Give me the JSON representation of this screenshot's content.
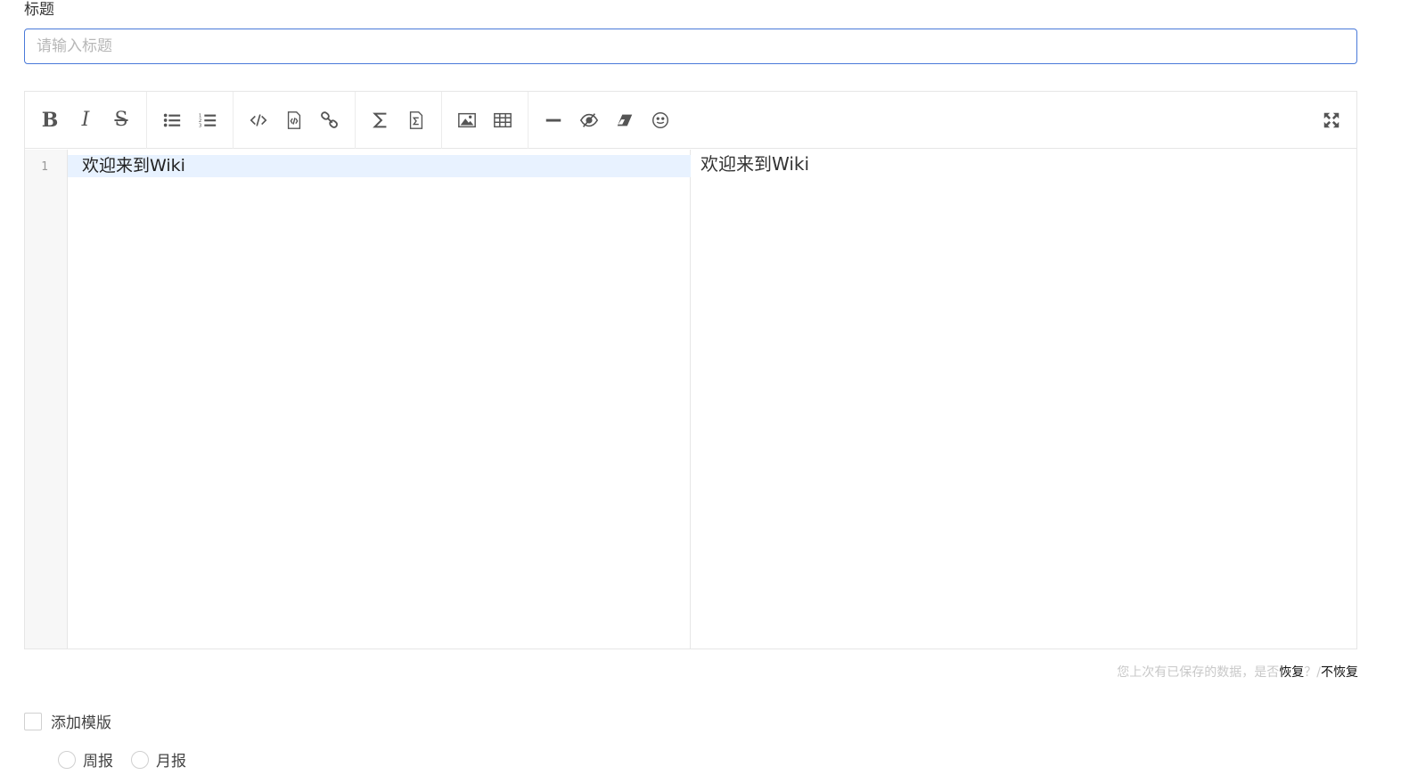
{
  "form": {
    "title_label": "标题",
    "title_placeholder": "请输入标题",
    "title_value": ""
  },
  "editor": {
    "toolbar": {
      "bold": "B",
      "italic": "I",
      "strike": "S",
      "icons": [
        "bold-icon",
        "italic-icon",
        "strikethrough-icon",
        "bullet-list-icon",
        "numbered-list-icon",
        "code-icon",
        "code-block-icon",
        "link-icon",
        "math-icon",
        "math-block-icon",
        "image-icon",
        "table-icon",
        "horizontal-rule-icon",
        "preview-toggle-icon",
        "clear-format-icon",
        "emoji-icon",
        "fullscreen-icon"
      ]
    },
    "line_number": "1",
    "code_line": "欢迎来到Wiki",
    "preview_text": "欢迎来到Wiki"
  },
  "restore": {
    "message": "您上次有已保存的数据，是否",
    "restore_link": "恢复",
    "separator": "？/",
    "discard_link": "不恢复"
  },
  "template": {
    "checkbox_label": "添加模版",
    "options": [
      "周报",
      "月报"
    ]
  },
  "colors": {
    "input_border": "#4a7ad9",
    "active_line": "#e8f2ff"
  }
}
